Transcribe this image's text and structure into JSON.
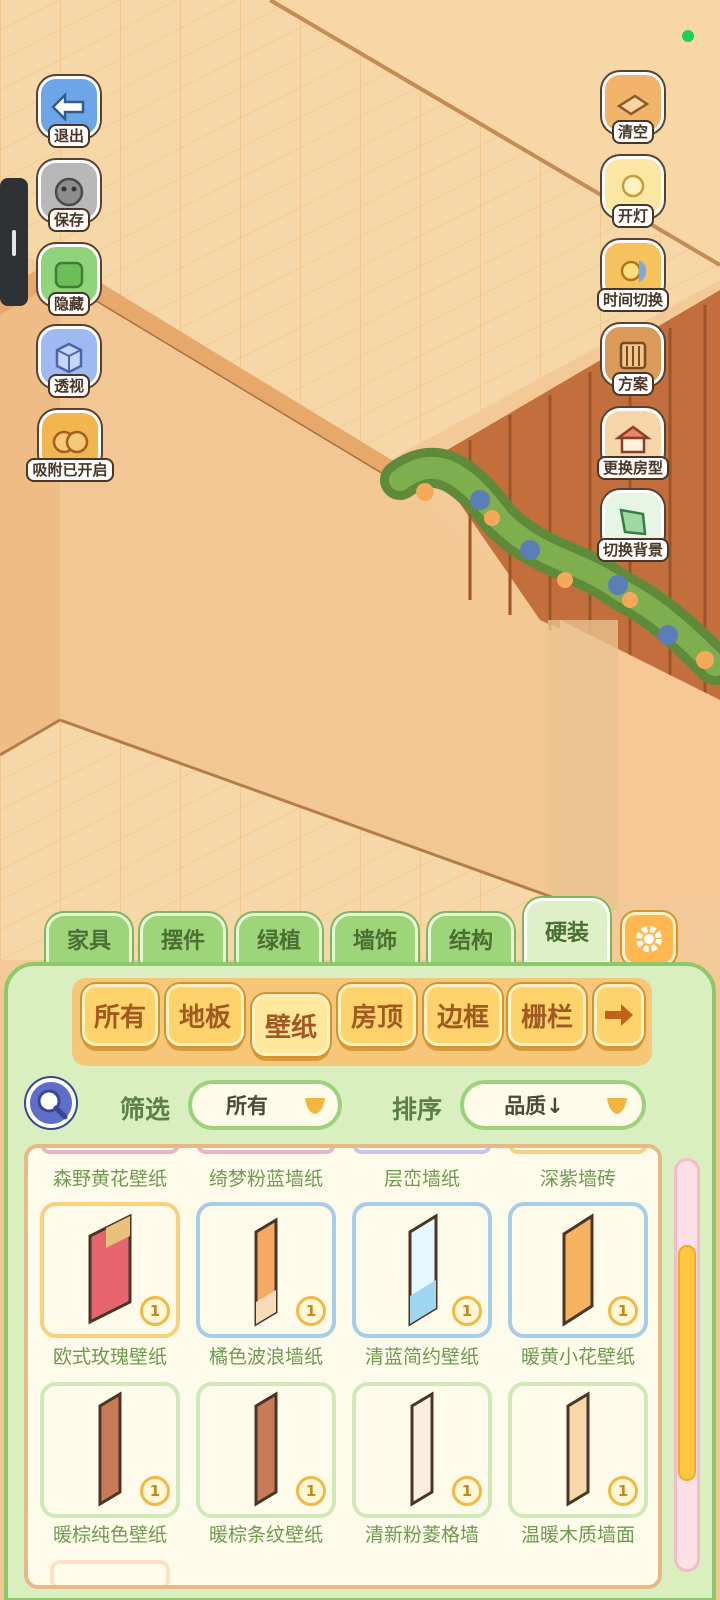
{
  "left_tools": [
    {
      "label": "退出",
      "icon": "exit-icon",
      "color": "#6da5e9"
    },
    {
      "label": "保存",
      "icon": "save-icon",
      "color": "#a6a6a6"
    },
    {
      "label": "隐藏",
      "icon": "hide-icon",
      "color": "#8fd47a"
    },
    {
      "label": "透视",
      "icon": "perspective-icon",
      "color": "#9fb9f2"
    },
    {
      "label": "吸附已开启",
      "icon": "snap-icon",
      "color": "#f1b64e"
    }
  ],
  "right_tools": [
    {
      "label": "清空",
      "icon": "clear-icon",
      "color": "#f2b36a"
    },
    {
      "label": "开灯",
      "icon": "light-icon",
      "color": "#fbe6a4"
    },
    {
      "label": "时间切换",
      "icon": "time-switch-icon",
      "color": "#f6c25d"
    },
    {
      "label": "方案",
      "icon": "plan-icon",
      "color": "#d99a5a"
    },
    {
      "label": "更换房型",
      "icon": "change-room-icon",
      "color": "#e8866c"
    },
    {
      "label": "切换背景",
      "icon": "switch-background-icon",
      "color": "#9ed8a3"
    }
  ],
  "tabs": [
    {
      "label": "家具",
      "active": false
    },
    {
      "label": "摆件",
      "active": false
    },
    {
      "label": "绿植",
      "active": false
    },
    {
      "label": "墙饰",
      "active": false
    },
    {
      "label": "结构",
      "active": false
    },
    {
      "label": "硬装",
      "active": true
    }
  ],
  "categories": [
    {
      "label": "所有",
      "active": false
    },
    {
      "label": "地板",
      "active": false
    },
    {
      "label": "壁纸",
      "active": true
    },
    {
      "label": "房顶",
      "active": false
    },
    {
      "label": "边框",
      "active": false
    },
    {
      "label": "栅栏",
      "active": false
    }
  ],
  "filter": {
    "label": "筛选",
    "value": "所有"
  },
  "sort": {
    "label": "排序",
    "value": "品质↓"
  },
  "top_row_names": [
    "森野黄花壁纸",
    "绮梦粉蓝墙纸",
    "层峦墙纸",
    "深紫墙砖"
  ],
  "items": [
    {
      "name": "欧式玫瑰壁纸",
      "count": "1",
      "frame": "gold",
      "color": "#e6656e",
      "accent": "#e8c27a"
    },
    {
      "name": "橘色波浪墙纸",
      "count": "1",
      "frame": "blue",
      "color": "#f7a964",
      "accent": "#f6dcb8"
    },
    {
      "name": "清蓝简约壁纸",
      "count": "1",
      "frame": "blue",
      "color": "#e6f7ff",
      "accent": "#9ed6ef"
    },
    {
      "name": "暖黄小花壁纸",
      "count": "1",
      "frame": "blue",
      "color": "#f6b25f",
      "accent": "#f6b25f"
    },
    {
      "name": "暖棕纯色壁纸",
      "count": "1",
      "frame": "green",
      "color": "#c97a56",
      "accent": "#c97a56"
    },
    {
      "name": "暖棕条纹壁纸",
      "count": "1",
      "frame": "green",
      "color": "#c97a56",
      "accent": "#b96b48"
    },
    {
      "name": "清新粉菱格墙",
      "count": "1",
      "frame": "green",
      "color": "#fbeee0",
      "accent": "#f1d7c0"
    },
    {
      "name": "温暖木质墙面",
      "count": "1",
      "frame": "green",
      "color": "#f8d8a8",
      "accent": "#f1c68b"
    }
  ],
  "colors": {
    "panel_green": "#d9efbf",
    "tab_green": "#9ed47a",
    "orange_button": "#ffd36b",
    "wall": "#f2c793",
    "floor": "#f5d3a2"
  }
}
